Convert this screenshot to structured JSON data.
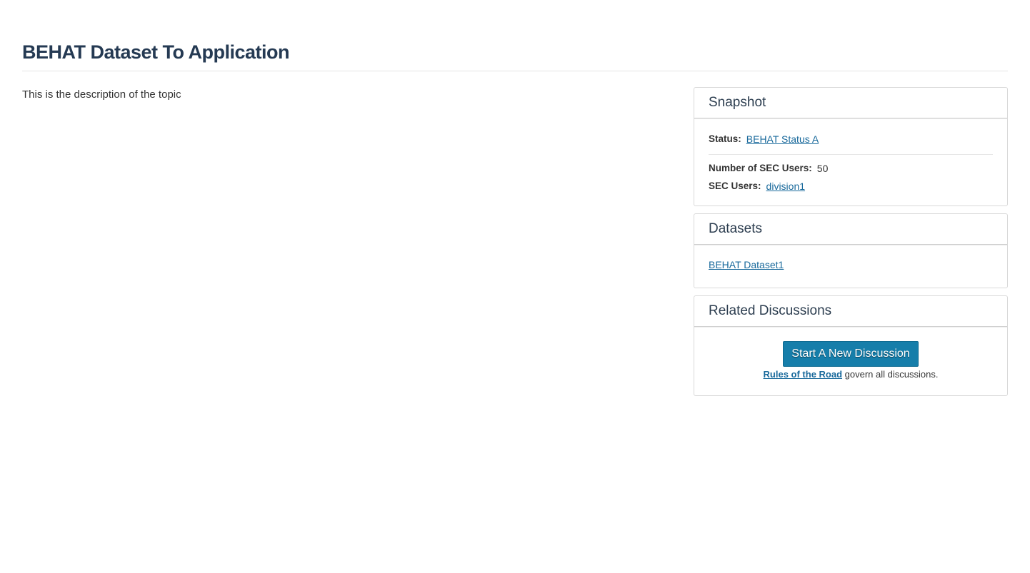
{
  "page": {
    "title": "BEHAT Dataset To Application",
    "description": "This is the description of the topic"
  },
  "snapshot": {
    "heading": "Snapshot",
    "status_label": "Status:",
    "status_value": "BEHAT Status A",
    "num_users_label": "Number of SEC Users:",
    "num_users_value": "50",
    "sec_users_label": "SEC Users:",
    "sec_users_value": "division1"
  },
  "datasets": {
    "heading": "Datasets",
    "items": [
      "BEHAT Dataset1"
    ]
  },
  "discussions": {
    "heading": "Related Discussions",
    "button_label": "Start A New Discussion",
    "rules_link": "Rules of the Road",
    "rules_suffix": " govern all discussions."
  },
  "colors": {
    "title": "#253a53",
    "link": "#1a6a9c",
    "button": "#167eaa"
  }
}
